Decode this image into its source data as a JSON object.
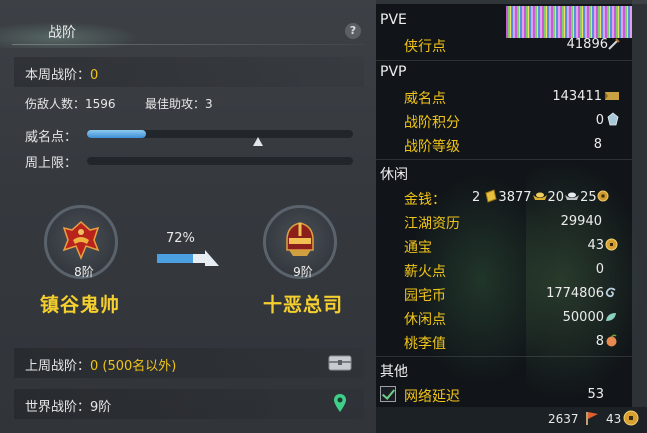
{
  "left_panel": {
    "header": {
      "title": "战阶",
      "help": "?"
    },
    "weekly_rank": {
      "label": "本周战阶：",
      "value": "0"
    },
    "stats": {
      "kills": "伤敌人数：1596",
      "best_assist": "最佳助攻：3"
    },
    "reputation_label": "威名点：",
    "reputation_progress": 0.22,
    "weekly_cap_label": "周上限：",
    "weekly_cap_progress": 0,
    "current": {
      "rank": "8阶",
      "title": "镇谷鬼帅"
    },
    "progress_percent": "72%",
    "next": {
      "rank": "9阶",
      "title": "十恶总司"
    },
    "last_week": {
      "label": "上周战阶：",
      "value": "0 (500名以外)"
    },
    "world": {
      "label": "世界战阶：",
      "value": "9阶"
    }
  },
  "right_panel": {
    "pve": {
      "title": "PVE",
      "items": [
        {
          "label": "侠行点",
          "value": "41896",
          "icon": "sword-icon"
        }
      ]
    },
    "pvp": {
      "title": "PVP",
      "items": [
        {
          "label": "威名点",
          "value": "143411",
          "icon": "banner-icon"
        },
        {
          "label": "战阶积分",
          "value": "0",
          "icon": "crystal-icon"
        },
        {
          "label": "战阶等级",
          "value": "8"
        }
      ]
    },
    "leisure": {
      "title": "休闲",
      "money": {
        "label": "金钱：",
        "gold": "2",
        "silver": "3877",
        "ingot": "20",
        "copper": "25"
      },
      "items": [
        {
          "label": "江湖资历",
          "value": "29940"
        },
        {
          "label": "通宝",
          "value": "43",
          "icon": "coin-icon"
        },
        {
          "label": "薪火点",
          "value": "0"
        },
        {
          "label": "园宅币",
          "value": "1774806",
          "icon": "swirl-icon"
        },
        {
          "label": "休闲点",
          "value": "50000",
          "icon": "leaf-icon"
        },
        {
          "label": "桃李值",
          "value": "8",
          "icon": "peach-icon"
        }
      ]
    },
    "other": {
      "title": "其他",
      "latency": {
        "label": "网络延迟",
        "value": "53",
        "checked": true
      }
    },
    "bottom": {
      "left_value": "2637",
      "right_value": "43"
    }
  }
}
